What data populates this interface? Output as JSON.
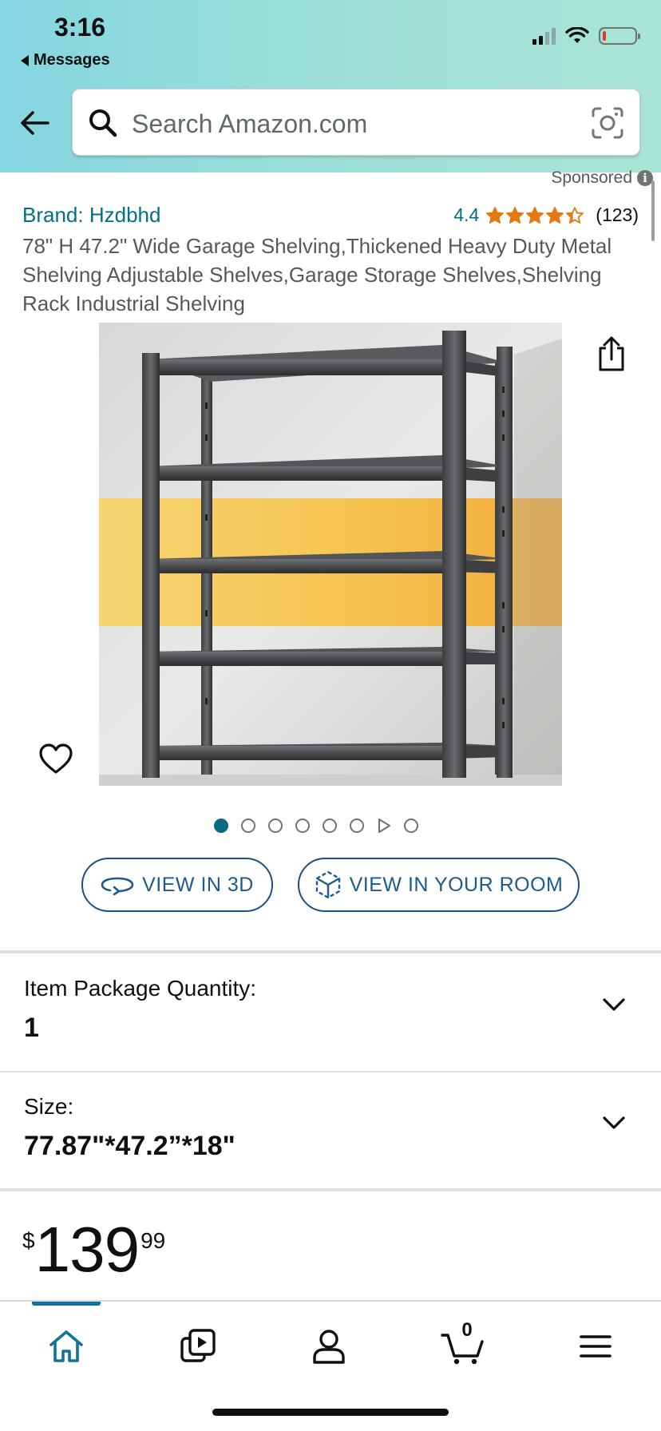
{
  "status_bar": {
    "time": "3:16",
    "back_to_app": "Messages"
  },
  "search": {
    "placeholder": "Search Amazon.com"
  },
  "sponsored": {
    "label": "Sponsored",
    "info_glyph": "i"
  },
  "product": {
    "brand": "Brand: Hzdbhd",
    "rating": "4.4",
    "rating_value": 4.4,
    "review_count": "(123)",
    "title": "78\" H 47.2\" Wide Garage Shelving,Thickened Heavy Duty Metal Shelving Adjustable Shelves,Garage Storage Shelves,Shelving Rack Industrial Shelving",
    "image_count": 8,
    "active_image": 1
  },
  "buttons": {
    "view_3d": "VIEW IN 3D",
    "view_room": "VIEW IN YOUR ROOM"
  },
  "options": {
    "quantity_label": "Item Package Quantity:",
    "quantity_value": "1",
    "size_label": "Size:",
    "size_value": "77.87\"*47.2”*18\""
  },
  "price": {
    "symbol": "$",
    "whole": "139",
    "fraction": "99"
  },
  "nav": {
    "items": [
      "home-icon",
      "video-icon",
      "account-icon",
      "cart-icon",
      "menu-icon"
    ],
    "cart_count": "0"
  },
  "colors": {
    "link_teal": "#007185",
    "star_orange": "#e47911",
    "pill_blue": "#1d5a8e",
    "active_dot": "#0b6a87"
  }
}
